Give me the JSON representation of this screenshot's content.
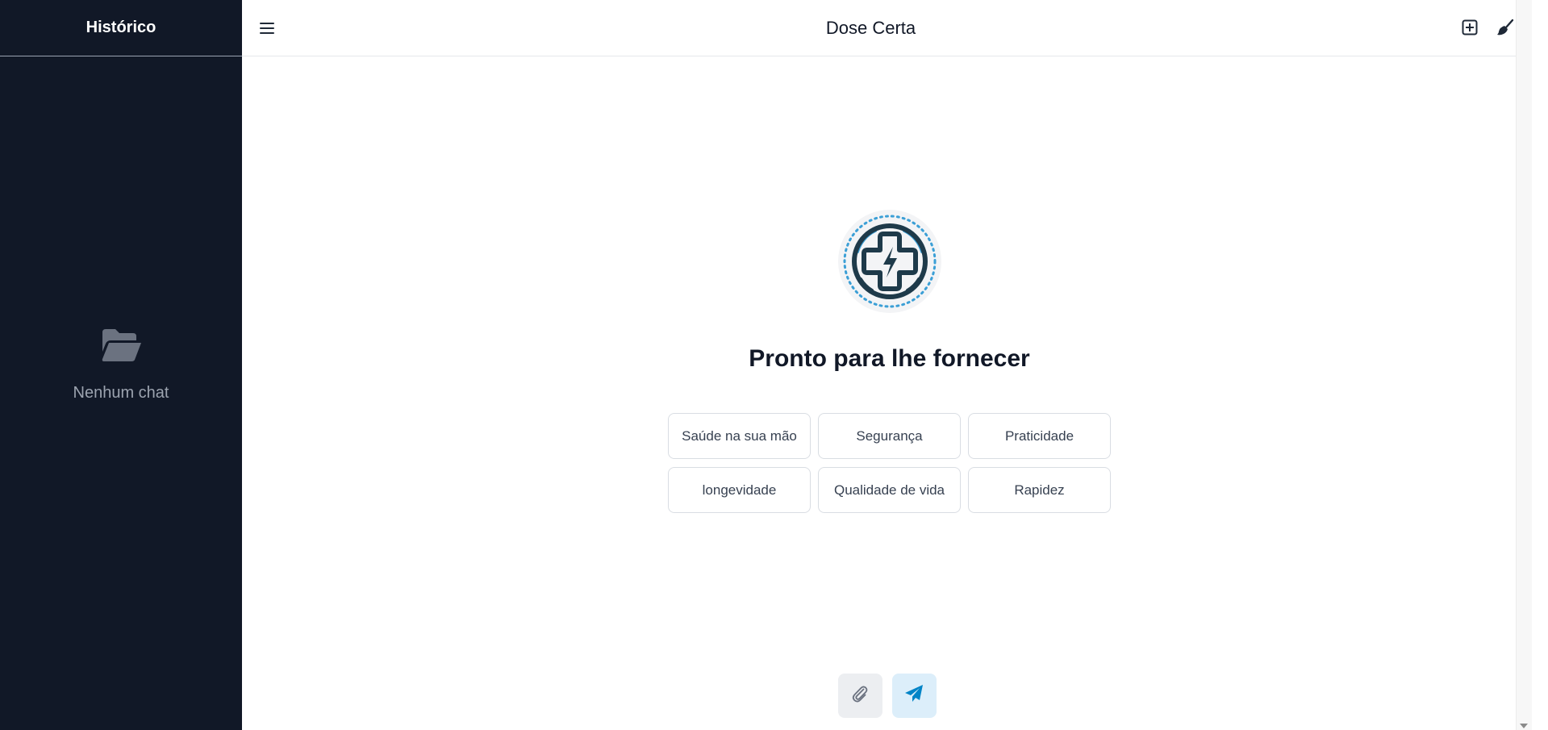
{
  "sidebar": {
    "title": "Histórico",
    "empty_text": "Nenhum chat",
    "empty_icon": "folder-open-icon"
  },
  "header": {
    "title": "Dose Certa",
    "menu_icon": "hamburger-menu-icon",
    "actions": [
      {
        "icon": "new-chat-plus-icon"
      },
      {
        "icon": "broom-clear-icon"
      }
    ]
  },
  "main": {
    "logo_icon": "medical-cross-lightning-icon",
    "headline": "Pronto para lhe fornecer",
    "suggestions": [
      "Saúde na sua mão",
      "Segurança",
      "Praticidade",
      "longevidade",
      "Qualidade de vida",
      "Rapidez"
    ]
  },
  "composer": {
    "attach_icon": "paperclip-icon",
    "send_icon": "paper-plane-send-icon"
  },
  "colors": {
    "sidebar_bg": "#111827",
    "accent": "#0284c7",
    "logo_dark": "#1e3a4a",
    "logo_light": "#3b9fd6"
  }
}
